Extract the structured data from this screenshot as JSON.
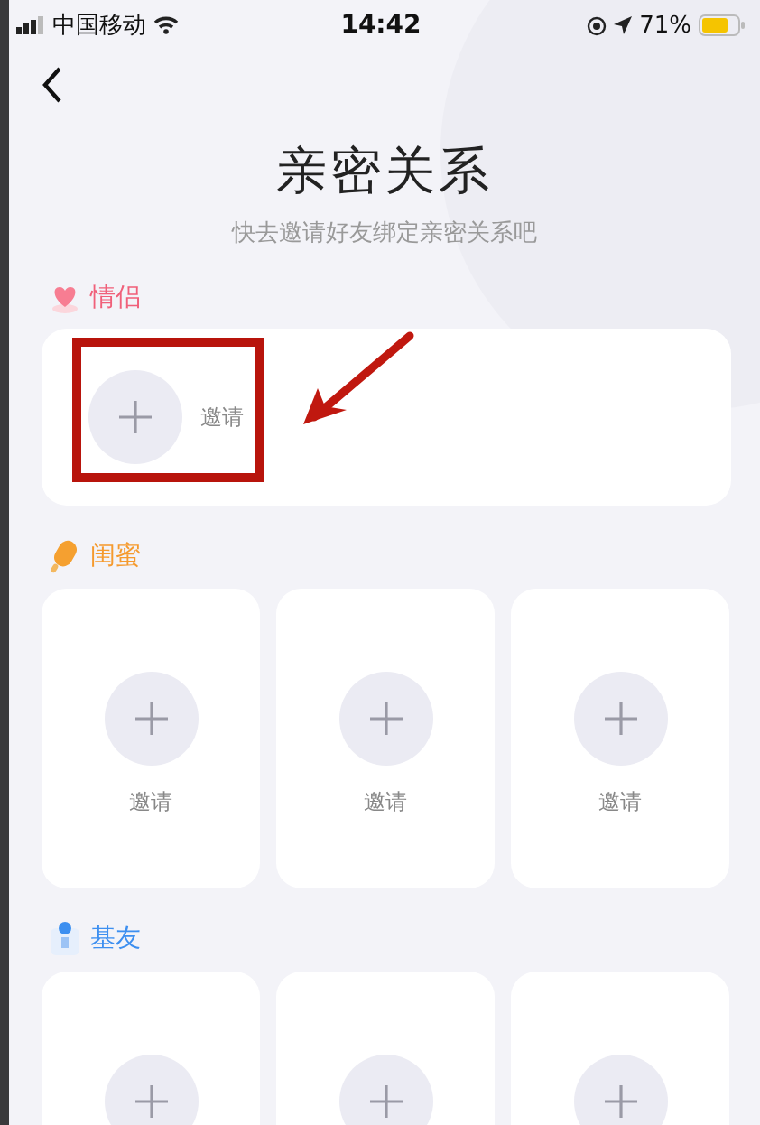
{
  "status_bar": {
    "carrier": "中国移动",
    "time": "14:42",
    "battery": "71%"
  },
  "title": "亲密关系",
  "subtitle": "快去邀请好友绑定亲密关系吧",
  "sections": [
    {
      "kind": "couple",
      "label": "情侣",
      "color": "#f0607a",
      "slots": [
        {
          "kind": "add",
          "label": "邀请"
        }
      ]
    },
    {
      "kind": "besties",
      "label": "闺蜜",
      "color": "#f59a2e",
      "slots": [
        {
          "kind": "add",
          "label": "邀请"
        },
        {
          "kind": "add",
          "label": "邀请"
        },
        {
          "kind": "add",
          "label": "邀请"
        }
      ]
    },
    {
      "kind": "buddies",
      "label": "基友",
      "color": "#3d8ff0",
      "slots": [
        {
          "kind": "add"
        },
        {
          "kind": "add"
        },
        {
          "kind": "add"
        }
      ]
    }
  ]
}
